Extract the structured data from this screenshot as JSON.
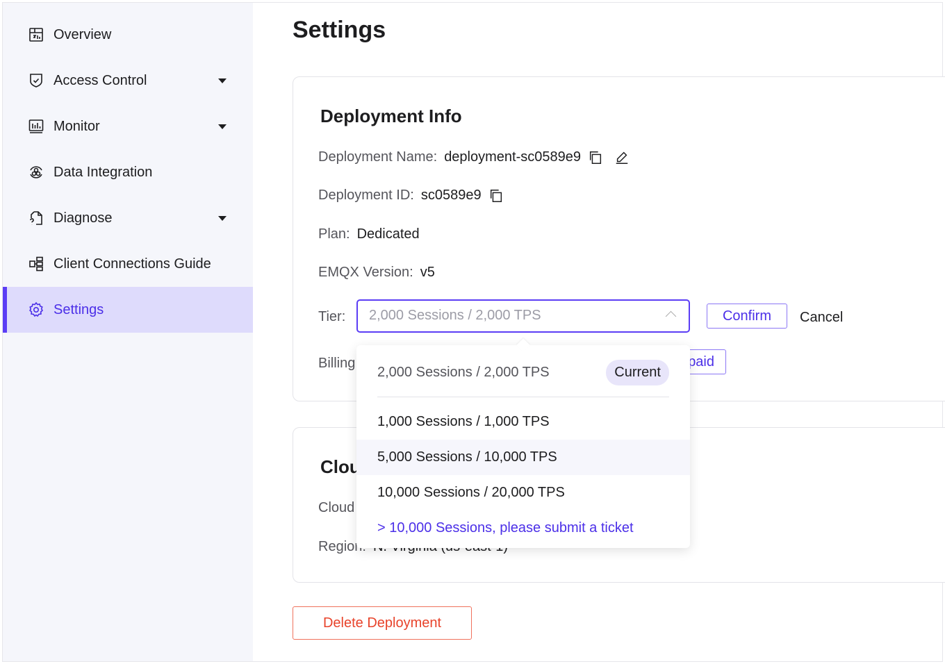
{
  "sidebar": {
    "items": [
      {
        "label": "Overview",
        "icon": "dashboard-icon"
      },
      {
        "label": "Access Control",
        "icon": "shield-check-icon",
        "expandable": true
      },
      {
        "label": "Monitor",
        "icon": "monitor-chart-icon",
        "expandable": true
      },
      {
        "label": "Data Integration",
        "icon": "integration-icon"
      },
      {
        "label": "Diagnose",
        "icon": "document-question-icon",
        "expandable": true
      },
      {
        "label": "Client Connections Guide",
        "icon": "connections-icon"
      },
      {
        "label": "Settings",
        "icon": "gear-icon",
        "active": true
      }
    ]
  },
  "page": {
    "title": "Settings"
  },
  "deployment": {
    "title": "Deployment Info",
    "name_label": "Deployment Name:",
    "name_value": "deployment-sc0589e9",
    "id_label": "Deployment ID:",
    "id_value": "sc0589e9",
    "plan_label": "Plan:",
    "plan_value": "Dedicated",
    "version_label": "EMQX Version:",
    "version_value": "v5",
    "tier_label": "Tier:",
    "tier_placeholder": "2,000 Sessions / 2,000 TPS",
    "confirm": "Confirm",
    "cancel": "Cancel",
    "billing_label": "Billing",
    "billing_button": "paid"
  },
  "tier_dropdown": {
    "current": "2,000 Sessions / 2,000 TPS",
    "current_badge": "Current",
    "options": [
      "1,000 Sessions / 1,000 TPS",
      "5,000 Sessions / 10,000 TPS",
      "10,000 Sessions / 20,000 TPS"
    ],
    "hovered_option": "5,000 Sessions / 10,000 TPS",
    "ticket_link": "> 10,000 Sessions, please submit a ticket"
  },
  "cloud": {
    "title": "Clou",
    "cloud_label": "Cloud",
    "region_label": "Region:",
    "region_value": "N. Virginia (us-east-1)"
  },
  "delete_button": "Delete Deployment",
  "colors": {
    "accent": "#5b3df5",
    "danger": "#e8432b",
    "active_bg": "#dedbfc",
    "sidebar_bg": "#f5f6fb"
  }
}
